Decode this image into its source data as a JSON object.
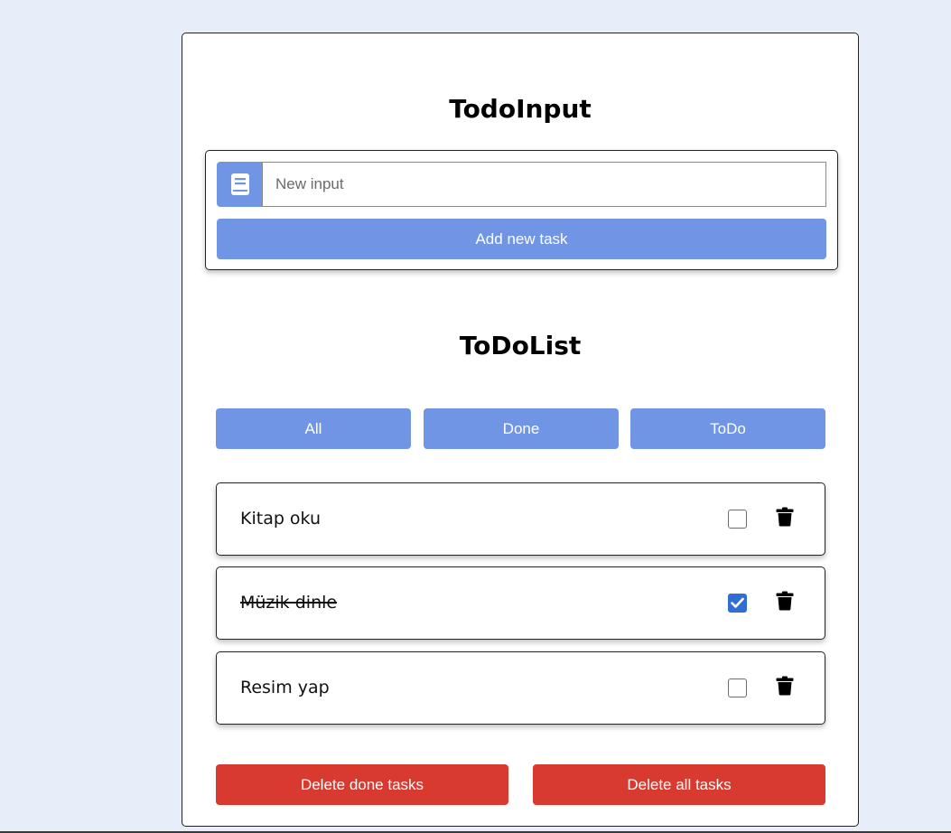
{
  "colors": {
    "page_background": "#e8eef9",
    "primary_blue": "#6f95e4",
    "danger_red": "#d83a2f",
    "checkbox_checked": "#2f6ed3"
  },
  "input_section": {
    "title": "TodoInput",
    "icon": "book-icon",
    "placeholder": "New input",
    "value": "",
    "add_button_label": "Add new task"
  },
  "list_section": {
    "title": "ToDoList",
    "filters": [
      {
        "label": "All"
      },
      {
        "label": "Done"
      },
      {
        "label": "ToDo"
      }
    ],
    "items": [
      {
        "text": "Kitap oku",
        "done": false
      },
      {
        "text": "Müzik dinle",
        "done": true
      },
      {
        "text": "Resim yap",
        "done": false
      }
    ],
    "delete_icon": "trash-icon"
  },
  "actions": {
    "delete_done_label": "Delete done tasks",
    "delete_all_label": "Delete all tasks"
  }
}
